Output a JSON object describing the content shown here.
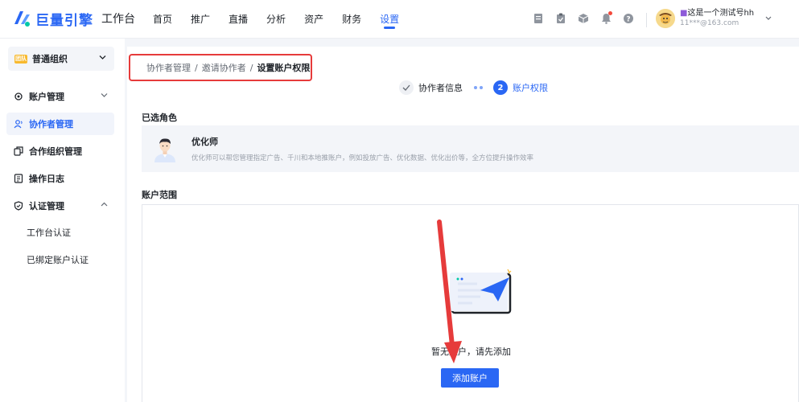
{
  "header": {
    "logo_text": "巨量引擎",
    "workspace": "工作台",
    "nav": [
      {
        "label": "首页",
        "active": false
      },
      {
        "label": "推广",
        "active": false
      },
      {
        "label": "直播",
        "active": false
      },
      {
        "label": "分析",
        "active": false
      },
      {
        "label": "资产",
        "active": false
      },
      {
        "label": "财务",
        "active": false
      },
      {
        "label": "设置",
        "active": true
      }
    ],
    "user": {
      "name": "这是一个测试号hh",
      "id": "11***@163.com"
    }
  },
  "sidebar": {
    "org_badge": "团队",
    "org_name": "普通组织",
    "items": [
      {
        "label": "账户管理",
        "icon": "gear-icon",
        "has_caret": true,
        "active": false
      },
      {
        "label": "协作者管理",
        "icon": "users-icon",
        "has_caret": false,
        "active": true
      },
      {
        "label": "合作组织管理",
        "icon": "copy-icon",
        "has_caret": false,
        "active": false
      },
      {
        "label": "操作日志",
        "icon": "log-icon",
        "has_caret": false,
        "active": false
      },
      {
        "label": "认证管理",
        "icon": "shield-icon",
        "has_caret": true,
        "active": false
      }
    ],
    "subitems": [
      "工作台认证",
      "已绑定账户认证"
    ]
  },
  "breadcrumb": {
    "items": [
      "协作者管理",
      "邀请协作者"
    ],
    "current": "设置账户权限",
    "separator": "/"
  },
  "steps": {
    "step1": "协作者信息",
    "step2_number": "2",
    "step2": "账户权限"
  },
  "role_section": {
    "title": "已选角色",
    "role_name": "优化师",
    "role_desc": "优化师可以帮您管理指定广告、千川和本地推账户，例如投放广告、优化数据、优化出价等，全方位提升操作效率"
  },
  "scope_section": {
    "title": "账户范围",
    "empty_text": "暂无账户，请先添加",
    "add_button": "添加账户"
  },
  "colors": {
    "brand": "#2a67f4",
    "highlight": "#e63b3b"
  }
}
